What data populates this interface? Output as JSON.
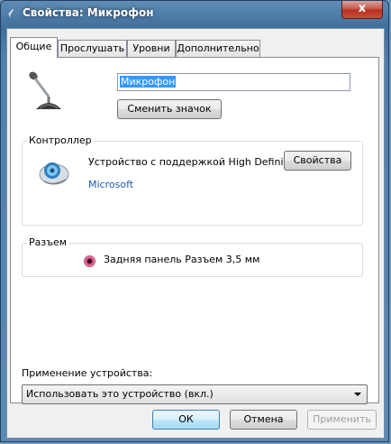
{
  "window": {
    "title": "Свойства: Микрофон",
    "close_label": "x"
  },
  "tabs": [
    {
      "label": "Общие",
      "active": true
    },
    {
      "label": "Прослушать",
      "active": false
    },
    {
      "label": "Уровни",
      "active": false
    },
    {
      "label": "Дополнительно",
      "active": false
    }
  ],
  "general": {
    "icon": "microphone-icon",
    "name_value": "Микрофон",
    "change_icon_label": "Сменить значок"
  },
  "controller": {
    "group_label": "Контроллер",
    "icon": "sound-card-icon",
    "device": "Устройство с поддержкой High Definit...",
    "properties_label": "Свойства",
    "vendor": "Microsoft"
  },
  "jack": {
    "group_label": "Разъем",
    "jack_color": "#c23a72",
    "label": "Задняя панель Разъем 3,5 мм"
  },
  "usage": {
    "label": "Применение устройства:",
    "selected": "Использовать это устройство (вкл.)"
  },
  "footer": {
    "ok_label": "ОК",
    "cancel_label": "Отмена",
    "apply_label": "Применить"
  }
}
